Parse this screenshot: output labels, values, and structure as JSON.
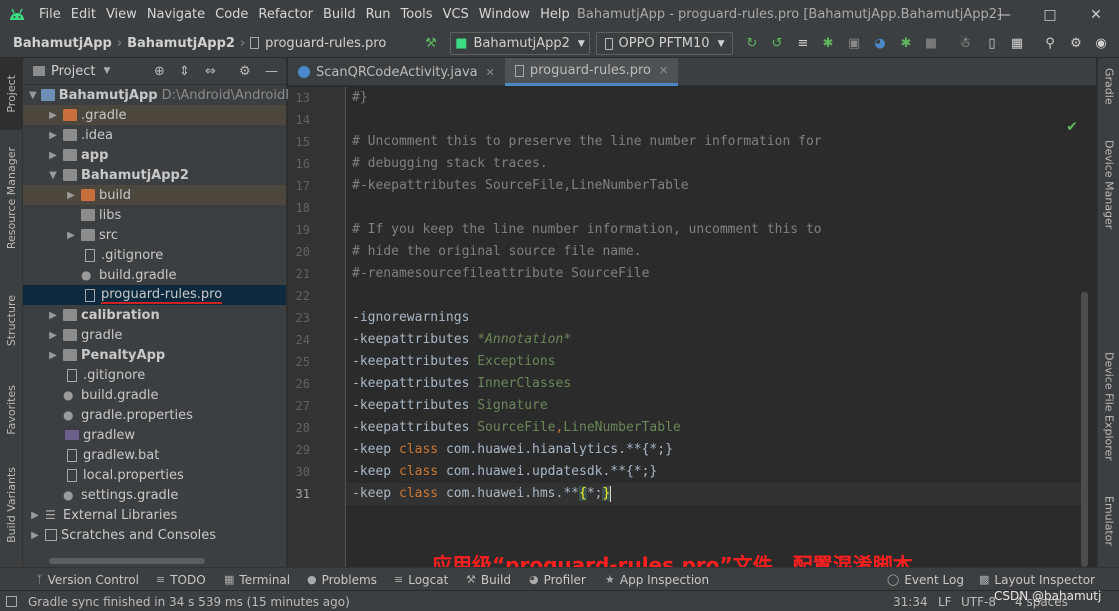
{
  "menu": [
    "File",
    "Edit",
    "View",
    "Navigate",
    "Code",
    "Refactor",
    "Build",
    "Run",
    "Tools",
    "VCS",
    "Window",
    "Help"
  ],
  "window_title": "BahamutjApp - proguard-rules.pro [BahamutjApp.BahamutjApp2]",
  "breadcrumb": {
    "root": "BahamutjApp",
    "module": "BahamutjApp2",
    "file": "proguard-rules.pro"
  },
  "toolbar": {
    "run_config": "BahamutjApp2",
    "device": "OPPO PFTM10"
  },
  "left_tools": [
    "Project",
    "Resource Manager",
    "Structure",
    "Favorites",
    "Build Variants"
  ],
  "right_tools": [
    "Gradle",
    "Device Manager",
    "Device File Explorer",
    "Emulator"
  ],
  "project_panel": {
    "title": "Project",
    "root_name": "BahamutjApp",
    "root_path": "D:\\Android\\AndroidPr",
    "items": [
      {
        "label": ".gradle"
      },
      {
        "label": ".idea"
      },
      {
        "label": "app"
      },
      {
        "label": "BahamutjApp2"
      },
      {
        "label": "build"
      },
      {
        "label": "libs"
      },
      {
        "label": "src"
      },
      {
        "label": ".gitignore"
      },
      {
        "label": "build.gradle"
      },
      {
        "label": "proguard-rules.pro"
      },
      {
        "label": "calibration"
      },
      {
        "label": "gradle"
      },
      {
        "label": "PenaltyApp"
      },
      {
        "label": ".gitignore"
      },
      {
        "label": "build.gradle"
      },
      {
        "label": "gradle.properties"
      },
      {
        "label": "gradlew"
      },
      {
        "label": "gradlew.bat"
      },
      {
        "label": "local.properties"
      },
      {
        "label": "settings.gradle"
      },
      {
        "label": "External Libraries"
      },
      {
        "label": "Scratches and Consoles"
      }
    ]
  },
  "editor": {
    "tabs": [
      "ScanQRCodeActivity.java",
      "proguard-rules.pro"
    ],
    "line_numbers": [
      "13",
      "14",
      "15",
      "16",
      "17",
      "18",
      "19",
      "20",
      "21",
      "22",
      "23",
      "24",
      "25",
      "26",
      "27",
      "28",
      "29",
      "30",
      "31"
    ],
    "lines": {
      "l13": "#}",
      "l15": "# Uncomment this to preserve the line number information for",
      "l16": "# debugging stack traces.",
      "l17": "#-keepattributes SourceFile,LineNumberTable",
      "l19": "# If you keep the line number information, uncomment this to",
      "l20": "# hide the original source file name.",
      "l21": "#-renamesourcefileattribute SourceFile",
      "l23": "-ignorewarnings",
      "kw_keepattributes": "-keepattributes",
      "a24": "*Annotation*",
      "a25": "Exceptions",
      "a26": "InnerClasses",
      "a27": "Signature",
      "a28a": "SourceFile",
      "a28b": "LineNumberTable",
      "kw_keep": "-keep",
      "kw_class": "class",
      "p29": "com.huawei.hianalytics.**{*;}",
      "p30": "com.huawei.updatesdk.**{*;}",
      "p31a": "com.huawei.hms.**",
      "p31b": "{",
      "p31c": "*;",
      "p31d": "}"
    },
    "annotation": "应用级“proguard-rules.pro”文件，配置混淆脚本"
  },
  "bottom_tools": [
    "Version Control",
    "TODO",
    "Terminal",
    "Problems",
    "Logcat",
    "Build",
    "Profiler",
    "App Inspection",
    "Event Log",
    "Layout Inspector"
  ],
  "status": {
    "message": "Gradle sync finished in 34 s 539 ms (15 minutes ago)",
    "position": "31:34",
    "line_sep": "LF",
    "encoding": "UTF-8",
    "indent": "4 spaces",
    "watermark": "CSDN @bahamutj"
  },
  "colors": {
    "accent": "#4a88c7",
    "annotation": "#ff1f1f",
    "keyword": "#cc7832",
    "string": "#6a8759"
  }
}
